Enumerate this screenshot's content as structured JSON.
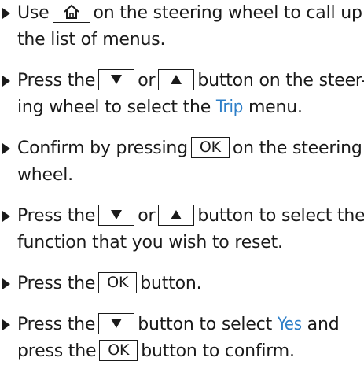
{
  "steps": [
    {
      "line1": {
        "pre": "Use",
        "post": "on the steering wheel to call up"
      },
      "line2": "the list of menus.",
      "keys": {
        "home": "home-icon"
      }
    },
    {
      "line1": {
        "pre": "Press the",
        "mid": "or",
        "post": "button on the steer-"
      },
      "line2": {
        "pre": "ing wheel to select the",
        "highlight": "Trip",
        "post": "menu."
      },
      "keys": {
        "down": "triangle-down-icon",
        "up": "triangle-up-icon"
      }
    },
    {
      "line1": {
        "pre": "Confirm by pressing",
        "key": "OK",
        "post": "on the steering"
      },
      "line2": "wheel."
    },
    {
      "line1": {
        "pre": "Press the",
        "mid": "or",
        "post": "button to select the"
      },
      "line2": "function that you wish to reset."
    },
    {
      "line1": {
        "pre": "Press the",
        "key": "OK",
        "post": "button."
      }
    },
    {
      "line1": {
        "pre": "Press the",
        "mid": "button to select",
        "highlight": "Yes",
        "post": "and"
      },
      "line2": {
        "pre": "press the",
        "key": "OK",
        "post": "button to confirm."
      }
    }
  ],
  "colors": {
    "text": "#1a1a1a",
    "highlight": "#2e7fc8"
  }
}
